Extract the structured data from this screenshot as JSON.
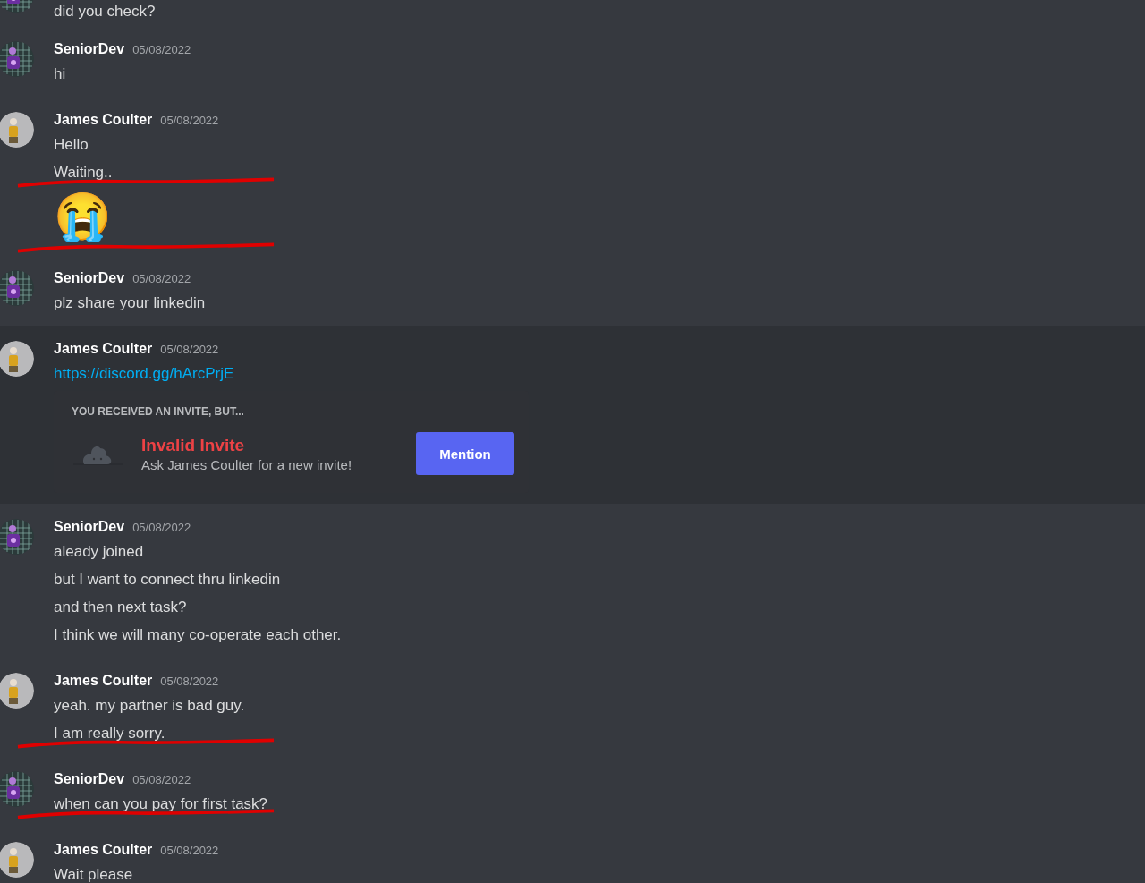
{
  "messages": [
    {
      "kind": "grid",
      "highlighted": false,
      "lines": [
        {
          "kind": "text",
          "text": "did you check?",
          "marked": false
        }
      ]
    },
    {
      "author": "SeniorDev",
      "timestamp": "05/08/2022",
      "kind": "grid",
      "highlighted": false,
      "lines": [
        {
          "kind": "text",
          "text": "hi",
          "marked": false
        }
      ]
    },
    {
      "author": "James Coulter",
      "timestamp": "05/08/2022",
      "kind": "figure",
      "highlighted": false,
      "lines": [
        {
          "kind": "text",
          "text": "Hello",
          "marked": false
        },
        {
          "kind": "text",
          "text": "Waiting..",
          "marked": true
        },
        {
          "kind": "emoji",
          "text": "😭",
          "marked": true
        }
      ]
    },
    {
      "author": "SeniorDev",
      "timestamp": "05/08/2022",
      "kind": "grid",
      "highlighted": false,
      "lines": [
        {
          "kind": "text",
          "text": "plz share your linkedin",
          "marked": false
        }
      ]
    },
    {
      "author": "James Coulter",
      "timestamp": "05/08/2022",
      "kind": "figure",
      "highlighted": true,
      "lines": [
        {
          "kind": "link",
          "text": "https://discord.gg/hArcPrjE",
          "marked": false
        }
      ],
      "invite": {
        "heading": "YOU RECEIVED AN INVITE, BUT...",
        "title": "Invalid Invite",
        "subtitle": "Ask James Coulter for a new invite!",
        "button": "Mention"
      }
    },
    {
      "author": "SeniorDev",
      "timestamp": "05/08/2022",
      "kind": "grid",
      "highlighted": false,
      "lines": [
        {
          "kind": "text",
          "text": "aleady joined",
          "marked": false
        },
        {
          "kind": "text",
          "text": "but I want to connect thru linkedin",
          "marked": false
        },
        {
          "kind": "text",
          "text": "and then next task?",
          "marked": false
        },
        {
          "kind": "text",
          "text": "I think we will many co-operate each other.",
          "marked": false
        }
      ]
    },
    {
      "author": "James Coulter",
      "timestamp": "05/08/2022",
      "kind": "figure",
      "highlighted": false,
      "lines": [
        {
          "kind": "text",
          "text": "yeah. my partner is bad guy.",
          "marked": false
        },
        {
          "kind": "text",
          "text": "I am really sorry.",
          "marked": true
        }
      ]
    },
    {
      "author": "SeniorDev",
      "timestamp": "05/08/2022",
      "kind": "grid",
      "highlighted": false,
      "lines": [
        {
          "kind": "text",
          "text": "when can you pay for first task?",
          "marked": true
        }
      ]
    },
    {
      "author": "James Coulter",
      "timestamp": "05/08/2022",
      "kind": "figure",
      "highlighted": false,
      "lines": [
        {
          "kind": "text",
          "text": "Wait please",
          "marked": false
        }
      ]
    }
  ]
}
